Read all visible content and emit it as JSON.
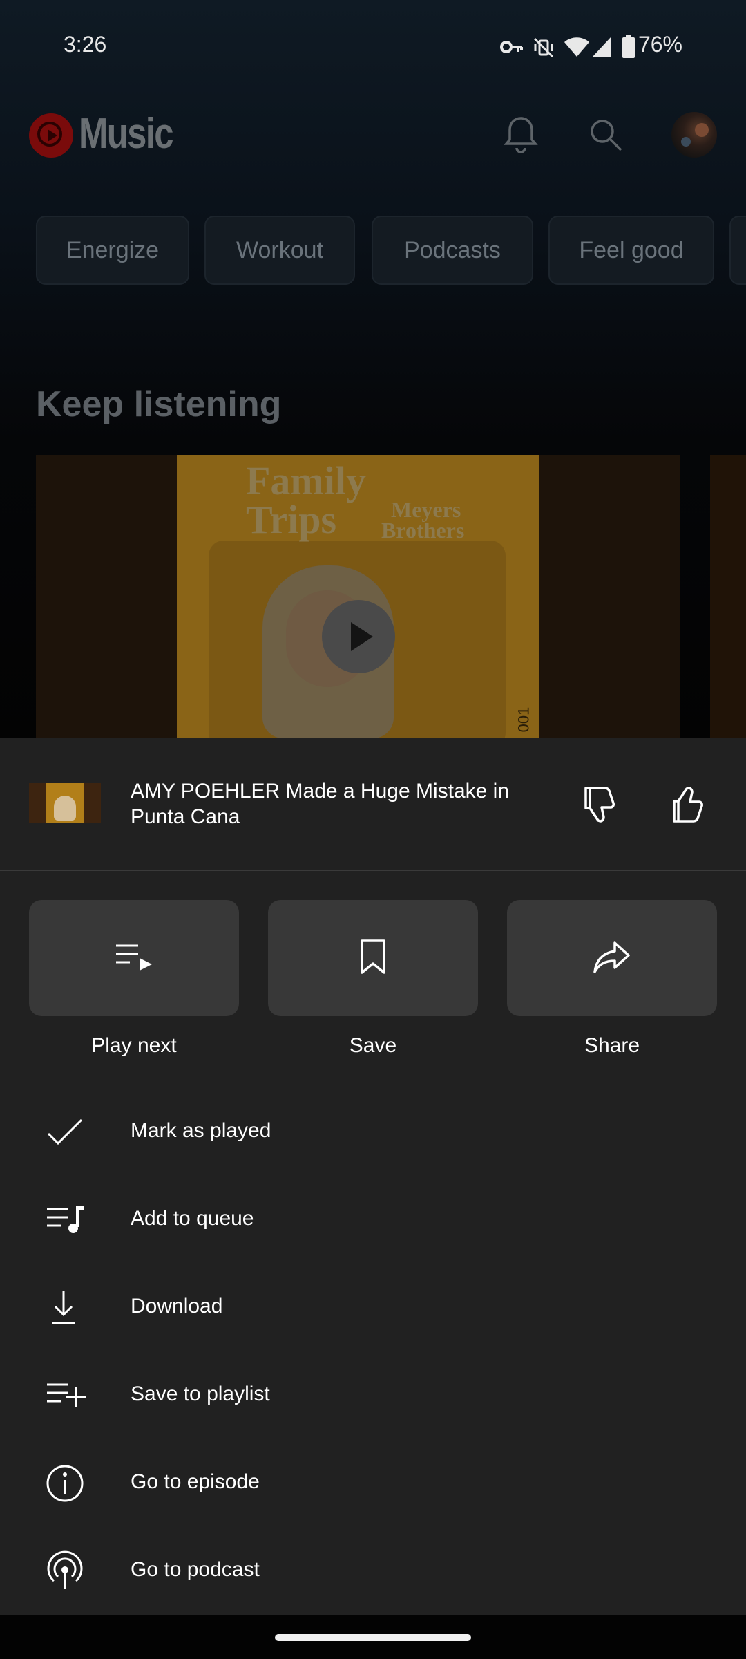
{
  "status_bar": {
    "time": "3:26",
    "battery": "76%",
    "icons": [
      "vpn-key-icon",
      "vibrate-off-icon",
      "wifi-icon",
      "signal-icon",
      "battery-icon"
    ]
  },
  "app_bar": {
    "logo_text": "Music",
    "icons": [
      "notifications-icon",
      "search-icon",
      "avatar"
    ]
  },
  "chips": [
    "Energize",
    "Workout",
    "Podcasts",
    "Feel good"
  ],
  "section": {
    "title": "Keep listening"
  },
  "card": {
    "art_title_line1": "Family",
    "art_title_line2": "Trips",
    "art_subtitle_line1": "Meyers",
    "art_subtitle_line2": "Brothers",
    "art_number": "001"
  },
  "sheet": {
    "episode_title": "AMY POEHLER Made a Huge Mistake in Punta Cana",
    "tiles": [
      {
        "label": "Play next",
        "icon": "play-next-icon"
      },
      {
        "label": "Save",
        "icon": "bookmark-icon"
      },
      {
        "label": "Share",
        "icon": "share-icon"
      }
    ],
    "menu": [
      {
        "label": "Mark as played",
        "icon": "check-icon"
      },
      {
        "label": "Add to queue",
        "icon": "add-to-queue-icon"
      },
      {
        "label": "Download",
        "icon": "download-icon"
      },
      {
        "label": "Save to playlist",
        "icon": "playlist-add-icon"
      },
      {
        "label": "Go to episode",
        "icon": "info-icon"
      },
      {
        "label": "Go to podcast",
        "icon": "podcast-icon"
      }
    ]
  },
  "colors": {
    "sheet_bg": "#212121",
    "tile_bg": "#383838",
    "brand_red": "#ff0000"
  }
}
